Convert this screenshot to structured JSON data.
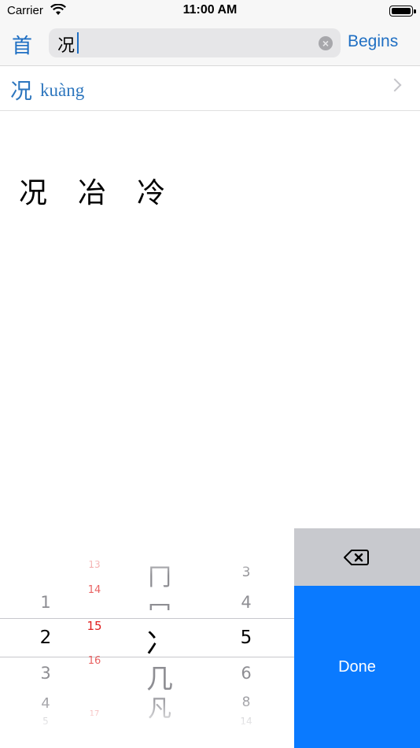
{
  "status_bar": {
    "carrier": "Carrier",
    "time": "11:00 AM"
  },
  "nav": {
    "radical_button": "首",
    "search_value": "况",
    "mode_button": "Begins"
  },
  "result": {
    "character": "况",
    "pinyin": "kuàng"
  },
  "related_characters": [
    "况",
    "冶",
    "冷"
  ],
  "picker": {
    "column1": [
      "1",
      "2",
      "3",
      "4",
      "5"
    ],
    "column2": [
      "13",
      "14",
      "15",
      "16",
      "17"
    ],
    "column3": [
      "冂",
      "冖",
      "冫",
      "几",
      "凡"
    ],
    "column4": [
      "3",
      "4",
      "5",
      "6",
      "8",
      "14"
    ]
  },
  "keys": {
    "done_label": "Done"
  },
  "colors": {
    "accent": "#1f6fc3",
    "done_bg": "#0a7aff",
    "delete_bg": "#c8c9ce",
    "stroke_count": "#e02020"
  }
}
